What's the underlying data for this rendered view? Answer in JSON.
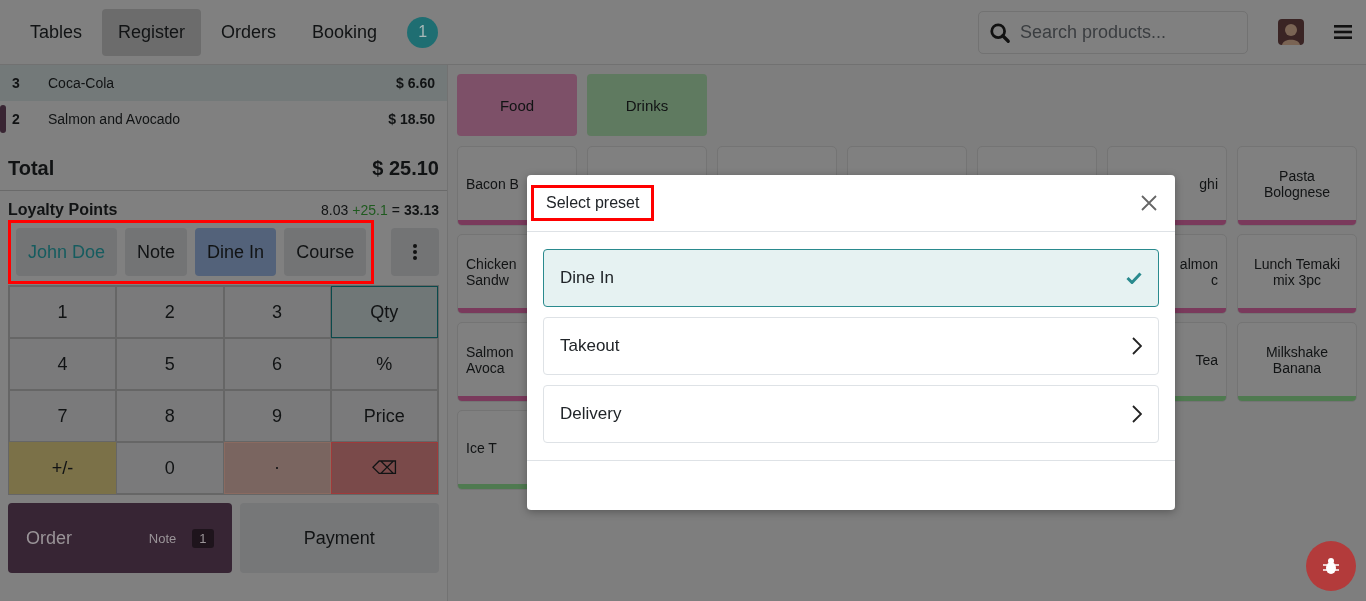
{
  "header": {
    "tabs": [
      {
        "label": "Tables",
        "selected": false
      },
      {
        "label": "Register",
        "selected": true
      },
      {
        "label": "Orders",
        "selected": false
      },
      {
        "label": "Booking",
        "selected": false
      }
    ],
    "badge": "1",
    "search": {
      "placeholder": "Search products..."
    }
  },
  "order_lines": [
    {
      "qty": "3",
      "name": "Coca-Cola",
      "price": "$ 6.60",
      "selected": true,
      "marked": false
    },
    {
      "qty": "2",
      "name": "Salmon and Avocado",
      "price": "$ 18.50",
      "selected": false,
      "marked": true
    }
  ],
  "total": {
    "label": "Total",
    "value": "$ 25.10"
  },
  "loyalty": {
    "label": "Loyalty Points",
    "current": "8.03",
    "gain": "+25.1",
    "equals": "=",
    "result": "33.13"
  },
  "actions": {
    "highlighted": true,
    "buttons": [
      {
        "label": "John Doe",
        "kind": "customer"
      },
      {
        "label": "Note",
        "kind": "plain"
      },
      {
        "label": "Dine In",
        "kind": "preset"
      },
      {
        "label": "Course",
        "kind": "plain"
      }
    ]
  },
  "numpad": [
    {
      "label": "1",
      "kind": "digit",
      "selected": false
    },
    {
      "label": "2",
      "kind": "digit",
      "selected": false
    },
    {
      "label": "3",
      "kind": "digit",
      "selected": false
    },
    {
      "label": "Qty",
      "kind": "mode",
      "selected": true
    },
    {
      "label": "4",
      "kind": "digit",
      "selected": false
    },
    {
      "label": "5",
      "kind": "digit",
      "selected": false
    },
    {
      "label": "6",
      "kind": "digit",
      "selected": false
    },
    {
      "label": "%",
      "kind": "mode",
      "selected": false
    },
    {
      "label": "7",
      "kind": "digit",
      "selected": false
    },
    {
      "label": "8",
      "kind": "digit",
      "selected": false
    },
    {
      "label": "9",
      "kind": "digit",
      "selected": false
    },
    {
      "label": "Price",
      "kind": "mode",
      "selected": false
    },
    {
      "label": "+/-",
      "kind": "sign",
      "selected": false
    },
    {
      "label": "0",
      "kind": "digit",
      "selected": false
    },
    {
      "label": ".",
      "kind": "dot",
      "selected": false
    },
    {
      "label": "⌫",
      "kind": "backspace",
      "selected": false
    }
  ],
  "order_button": {
    "label": "Order",
    "note": "Note",
    "count": "1"
  },
  "payment_button": {
    "label": "Payment"
  },
  "categories": [
    {
      "label": "Food",
      "color": "#7d5068"
    },
    {
      "label": "Drinks",
      "color": "#5f7a60"
    }
  ],
  "products": [
    {
      "kind": "product",
      "name": "Bacon B",
      "color": "#7a3a5c"
    },
    {
      "kind": "covered"
    },
    {
      "kind": "covered"
    },
    {
      "kind": "covered"
    },
    {
      "kind": "covered"
    },
    {
      "kind": "product",
      "name": "ghi",
      "color": "#7a3a5c"
    },
    {
      "kind": "product",
      "name": "Pasta Bolognese",
      "color": "#7a3a5c"
    },
    {
      "kind": "product",
      "name": "Chicken Sandw",
      "color": "#7a3a5c"
    },
    {
      "kind": "hidden"
    },
    {
      "kind": "hidden"
    },
    {
      "kind": "hidden"
    },
    {
      "kind": "hidden"
    },
    {
      "kind": "product",
      "name": "almon c",
      "color": "#7a3a5c"
    },
    {
      "kind": "product",
      "name": "Lunch Temaki mix 3pc",
      "color": "#7a3a5c"
    },
    {
      "kind": "product",
      "name": "Salmon Avoca",
      "color": "#7a3a5c"
    },
    {
      "kind": "hidden"
    },
    {
      "kind": "hidden"
    },
    {
      "kind": "hidden"
    },
    {
      "kind": "hidden"
    },
    {
      "kind": "product",
      "name": "Tea",
      "color": "#4f7a50"
    },
    {
      "kind": "product",
      "name": "Milkshake Banana",
      "color": "#4f7a50"
    },
    {
      "kind": "product",
      "name": "Ice T",
      "color": "#4f7a50"
    }
  ],
  "modal": {
    "title": "Select preset",
    "title_highlighted": true,
    "options": [
      {
        "label": "Dine In",
        "selected": true
      },
      {
        "label": "Takeout",
        "selected": false
      },
      {
        "label": "Delivery",
        "selected": false
      }
    ]
  }
}
